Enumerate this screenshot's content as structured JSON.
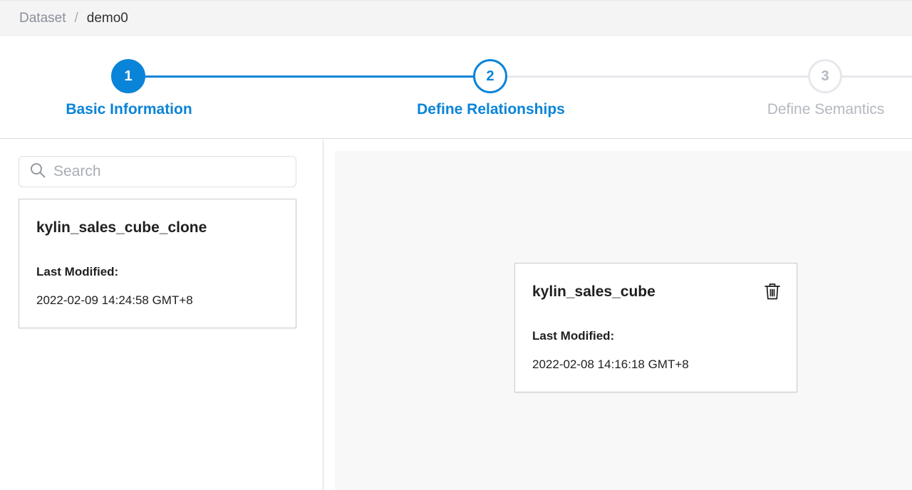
{
  "breadcrumb": {
    "root": "Dataset",
    "separator": "/",
    "current": "demo0"
  },
  "stepper": {
    "steps": [
      {
        "number": "1",
        "label": "Basic Information",
        "state": "completed"
      },
      {
        "number": "2",
        "label": "Define Relationships",
        "state": "active"
      },
      {
        "number": "3",
        "label": "Define Semantics",
        "state": "pending"
      }
    ],
    "colors": {
      "active": "#0a84d8",
      "pending": "#b4b8bf"
    }
  },
  "left_panel": {
    "search": {
      "placeholder": "Search",
      "value": "",
      "icon": "search-icon"
    },
    "cubes": [
      {
        "name": "kylin_sales_cube_clone",
        "modified_label": "Last Modified:",
        "modified_value": "2022-02-09 14:24:58 GMT+8"
      }
    ]
  },
  "canvas": {
    "cubes": [
      {
        "name": "kylin_sales_cube",
        "modified_label": "Last Modified:",
        "modified_value": "2022-02-08 14:16:18 GMT+8",
        "icon": "trash-icon"
      }
    ]
  }
}
